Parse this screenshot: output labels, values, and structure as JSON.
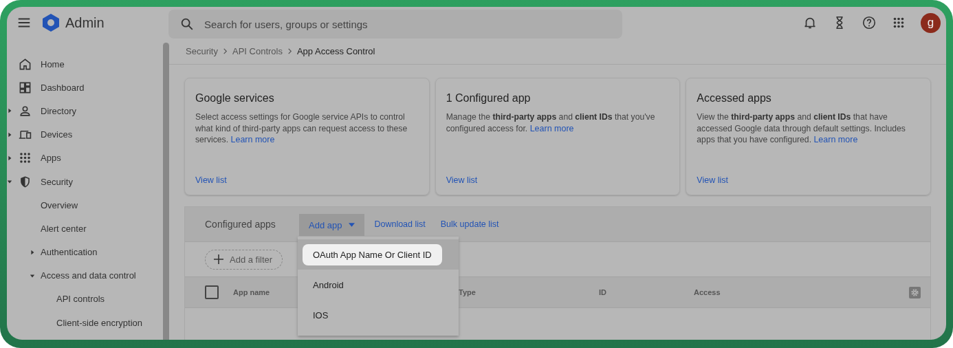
{
  "header": {
    "product": "Admin",
    "search": {
      "placeholder": "Search for users, groups or settings"
    },
    "avatar": "g"
  },
  "sidebar": {
    "items": [
      {
        "label": "Home"
      },
      {
        "label": "Dashboard"
      },
      {
        "label": "Directory",
        "expanded": false
      },
      {
        "label": "Devices",
        "expanded": false
      },
      {
        "label": "Apps",
        "expanded": false
      },
      {
        "label": "Security",
        "expanded": true,
        "children": [
          {
            "label": "Overview"
          },
          {
            "label": "Alert center"
          },
          {
            "label": "Authentication",
            "expanded": false
          },
          {
            "label": "Access and data control",
            "expanded": true,
            "children": [
              {
                "label": "API controls"
              },
              {
                "label": "Client-side encryption"
              }
            ]
          }
        ]
      }
    ]
  },
  "breadcrumb": [
    "Security",
    "API Controls",
    "App Access Control"
  ],
  "cards": [
    {
      "title": "Google services",
      "description": "Select access settings for Google service APIs to control what kind of third-party apps can request access to these services.",
      "link": "Learn more",
      "action": "View list"
    },
    {
      "title": "1 Configured app",
      "description": "Manage the **third-party apps** and **client IDs** that you've configured access for.",
      "link": "Learn more",
      "action": "View list"
    },
    {
      "title": "Accessed apps",
      "description": "View the **third-party apps** and **client IDs** that have accessed Google data through default settings. Includes apps that you have configured.",
      "link": "Learn more",
      "action": "View list"
    }
  ],
  "configured_apps": {
    "title": "Configured apps",
    "add_button": "Add app",
    "actions": [
      "Download list",
      "Bulk update list"
    ],
    "menu": [
      {
        "label": "OAuth App Name Or Client ID",
        "selected": true
      },
      {
        "label": "Android",
        "selected": false
      },
      {
        "label": "IOS",
        "selected": false
      }
    ],
    "filter": "Add a filter",
    "select_all": {
      "checked": false
    },
    "columns": [
      "App name",
      "Type",
      "ID",
      "Access"
    ]
  }
}
